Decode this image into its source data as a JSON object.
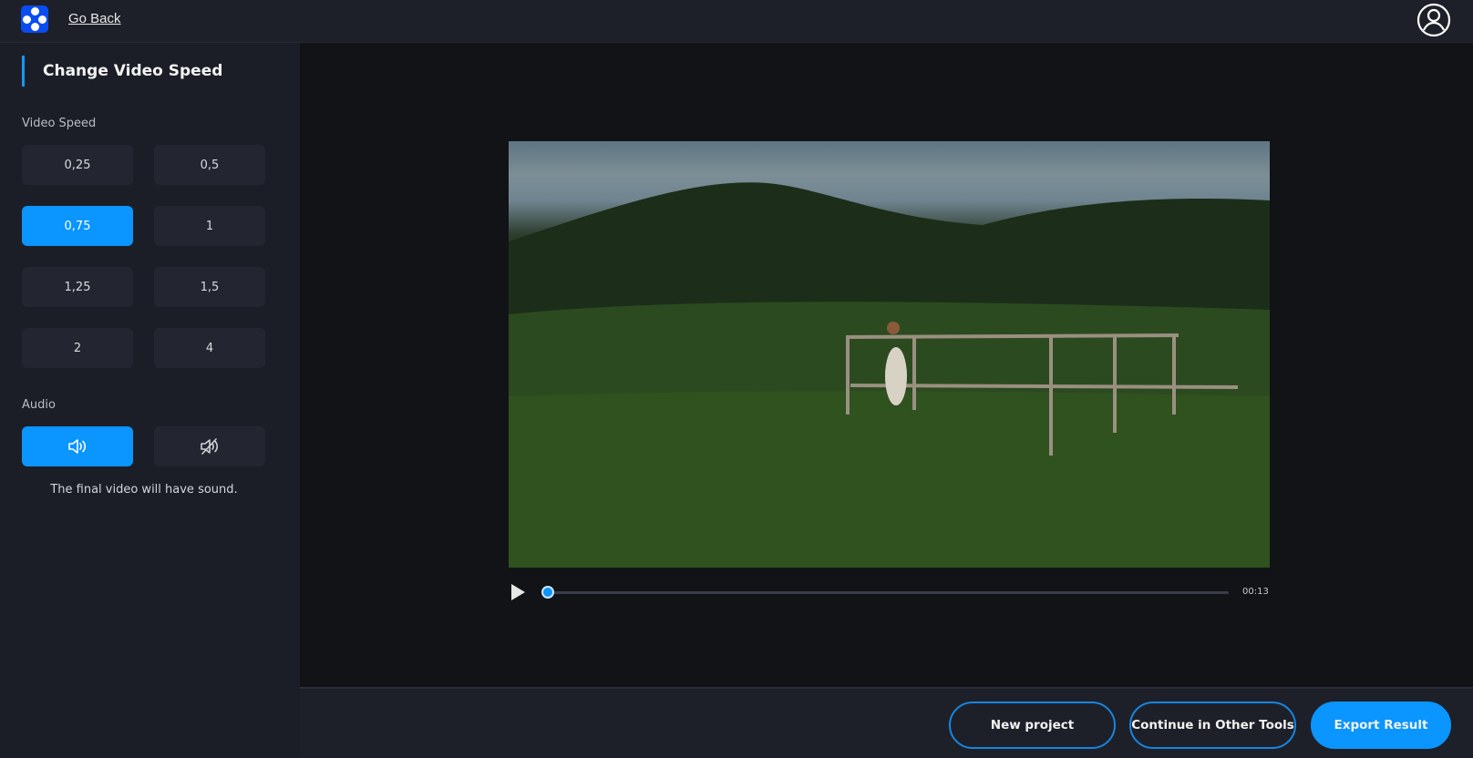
{
  "header": {
    "go_back": "Go Back"
  },
  "sidebar": {
    "title": "Change Video Speed",
    "speed_label": "Video Speed",
    "speeds": [
      "0,25",
      "0,5",
      "0,75",
      "1",
      "1,25",
      "1,5",
      "2",
      "4"
    ],
    "selected_speed": "0,75",
    "audio_label": "Audio",
    "audio_selected": "sound-on",
    "audio_note": "The final video will have sound."
  },
  "player": {
    "duration": "00:13",
    "progress": 0.0
  },
  "footer": {
    "new_project": "New project",
    "continue": "Continue in Other Tools",
    "export": "Export Result"
  },
  "colors": {
    "accent": "#0a95ff",
    "logo": "#0a4cf0"
  }
}
